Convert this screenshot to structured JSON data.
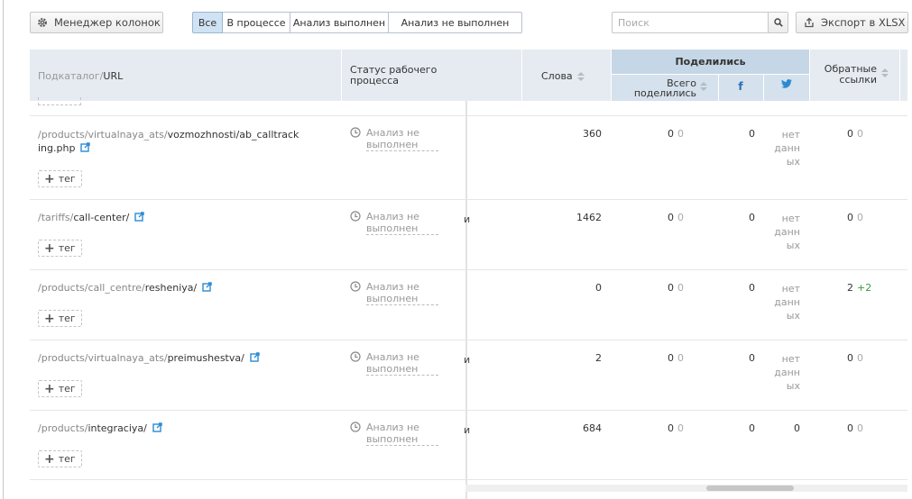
{
  "toolbar": {
    "column_manager_label": "Менеджер колонок",
    "filters": [
      "Все",
      "В процессе",
      "Анализ выполнен",
      "Анализ не выполнен"
    ],
    "active_filter": "Все",
    "search_placeholder": "Поиск",
    "export_label": "Экспорт в XLSX"
  },
  "header": {
    "url_prefix": "Подкаталог/",
    "url_main": "URL",
    "status": "Статус рабочего процесса",
    "words": "Слова",
    "shares_group": "Поделились",
    "total_shares": "Всего поделились",
    "backlinks": "Обратные ссылки"
  },
  "status_label": "Анализ не выполнен",
  "tag_label": "тег",
  "no_data_label": "нет данн ых",
  "colors": {
    "accent": "#2b8ad3",
    "header_bg": "#e5ebf1",
    "shares_bg": "#c5d6e6",
    "positive": "#3c9a3c"
  },
  "rows": [
    {
      "url_sub": "/products/virtualnaya_ats/",
      "url_main": "vozmozhnosti/ab_calltrack ing.php",
      "fragment": "",
      "words": "360",
      "total_shares": "0",
      "total_delta": "0",
      "facebook": "0",
      "twitter": "нет данн ых",
      "backlinks": "0",
      "backlinks_delta": "0"
    },
    {
      "url_sub": "/tariffs/",
      "url_main": "call-center/",
      "fragment": "и",
      "words": "1462",
      "total_shares": "0",
      "total_delta": "0",
      "facebook": "0",
      "twitter": "нет данн ых",
      "backlinks": "0",
      "backlinks_delta": "0"
    },
    {
      "url_sub": "/products/call_centre/",
      "url_main": "resheniya/",
      "fragment": "",
      "words": "0",
      "total_shares": "0",
      "total_delta": "0",
      "facebook": "0",
      "twitter": "нет данн ых",
      "backlinks": "2",
      "backlinks_delta": "+2"
    },
    {
      "url_sub": "/products/virtualnaya_ats/",
      "url_main": "preimushestva/",
      "fragment": "и",
      "words": "2",
      "total_shares": "0",
      "total_delta": "0",
      "facebook": "0",
      "twitter": "нет данн ых",
      "backlinks": "0",
      "backlinks_delta": "0"
    },
    {
      "url_sub": "/products/",
      "url_main": "integraciya/",
      "fragment": "и",
      "words": "684",
      "total_shares": "0",
      "total_delta": "0",
      "facebook": "0",
      "twitter": "0",
      "backlinks": "0",
      "backlinks_delta": "0"
    }
  ]
}
